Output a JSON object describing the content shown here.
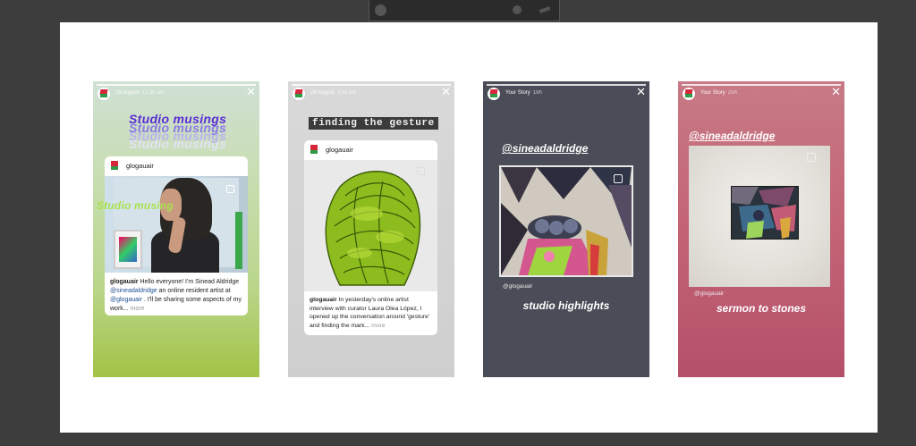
{
  "stories": [
    {
      "date": "28 August",
      "time": "11:30 am",
      "title_stack": [
        "Studio musings",
        "Studio musings",
        "Studio musings",
        "Studio musings"
      ],
      "post": {
        "username": "glogauair",
        "overlay_text": "Studio musing",
        "caption_user": "glogauair",
        "caption_parts": [
          " Hello everyone! I'm Sinead Aldridge ",
          "@sineadaldridge",
          " an online resident artist at ",
          "@glogauair",
          " . I'll be sharing some aspects of my work..."
        ],
        "more": " more"
      }
    },
    {
      "date": "28 August",
      "time": "3:58 pm",
      "headline": "finding the gesture",
      "post": {
        "username": "glogauair",
        "caption_user": "glogauair",
        "caption_text": " In yesterday's online artist interview with curator Laura Olea López, I opened up the conversation around 'gesture' and finding the mark...",
        "more": " more"
      }
    },
    {
      "label": "Your Story",
      "time": "19h",
      "mention": "@sineadaldridge",
      "handle": "@glogauair",
      "caption": "studio highlights"
    },
    {
      "label": "Your Story",
      "time": "20h",
      "mention": "@sineadaldridge",
      "handle": "@glogauair",
      "caption": "sermon to stones"
    }
  ],
  "colors": {
    "workspace_bg": "#3d3d3d",
    "canvas_bg": "#ffffff",
    "story1_gradient_bottom": "#a3c246",
    "story3_bg": "#4a4d57",
    "story4_bg": "#c46677",
    "title_purple": "#5a2cd6",
    "overlay_green": "#a9e24e",
    "link_blue": "#1f4e94"
  },
  "icons": {
    "close": "close-icon",
    "avatar": "glogau-logo-icon",
    "save": "square-icon"
  }
}
